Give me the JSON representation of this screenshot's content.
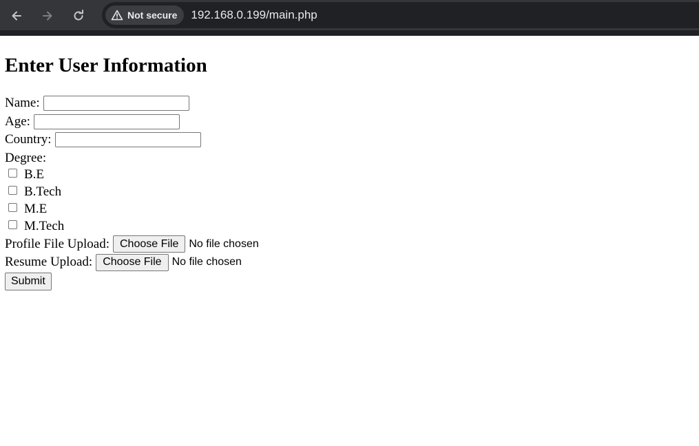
{
  "browser": {
    "security_label": "Not secure",
    "url": "192.168.0.199/main.php",
    "icons": [
      "back-arrow-icon",
      "forward-arrow-icon",
      "reload-icon",
      "warning-triangle-icon"
    ]
  },
  "page": {
    "title": "Enter User Information",
    "fields": {
      "name_label": "Name:",
      "age_label": "Age:",
      "country_label": "Country:",
      "name_value": "",
      "age_value": "",
      "country_value": ""
    },
    "degree": {
      "label": "Degree:",
      "options": [
        "B.E",
        "B.Tech",
        "M.E",
        "M.Tech"
      ]
    },
    "profile_upload": {
      "label": "Profile File Upload:",
      "button": "Choose File",
      "status": "No file chosen"
    },
    "resume_upload": {
      "label": "Resume Upload:",
      "button": "Choose File",
      "status": "No file chosen"
    },
    "submit_label": "Submit"
  }
}
